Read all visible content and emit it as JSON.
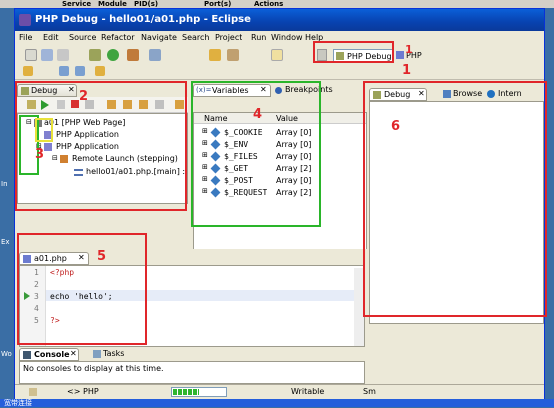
{
  "desktop": {
    "top_strip": [
      "Service",
      "Module",
      "PID(s)",
      "Port(s)",
      "Actions"
    ],
    "left_labels": [
      "In",
      "Ex",
      "Wo"
    ],
    "taskbar_label": "宽带连接"
  },
  "window": {
    "title": "PHP Debug - hello01/a01.php - Eclipse"
  },
  "menu": [
    "File",
    "Edit",
    "Source",
    "Refactor",
    "Navigate",
    "Search",
    "Project",
    "Run",
    "Window",
    "Help"
  ],
  "perspectives": {
    "active": "PHP Debug",
    "other": "PHP"
  },
  "debug_view": {
    "tab_label": "Debug",
    "tree": [
      {
        "label": "a01 [PHP Web Page]",
        "level": 0
      },
      {
        "label": "PHP Application",
        "level": 1
      },
      {
        "label": "PHP Application",
        "level": 1
      },
      {
        "label": "Remote Launch (stepping)",
        "level": 2
      },
      {
        "label": "hello01/a01.php.[main] :",
        "level": 3
      }
    ]
  },
  "variables_view": {
    "tabs": [
      "Variables",
      "Breakpoints"
    ],
    "columns": [
      "Name",
      "Value"
    ],
    "rows": [
      {
        "name": "$_COOKIE",
        "value": "Array [0]"
      },
      {
        "name": "$_ENV",
        "value": "Array [0]"
      },
      {
        "name": "$_FILES",
        "value": "Array [0]"
      },
      {
        "name": "$_GET",
        "value": "Array [2]"
      },
      {
        "name": "$_POST",
        "value": "Array [0]"
      },
      {
        "name": "$_REQUEST",
        "value": "Array [2]"
      }
    ]
  },
  "right_view": {
    "tabs": [
      "Debug",
      "Browse",
      "Intern"
    ]
  },
  "editor": {
    "tab_label": "a01.php",
    "lines": [
      {
        "num": "1",
        "code": "<?php"
      },
      {
        "num": "2",
        "code": ""
      },
      {
        "num": "3",
        "code": "echo 'hello';"
      },
      {
        "num": "4",
        "code": ""
      },
      {
        "num": "5",
        "code": "?>"
      }
    ]
  },
  "console": {
    "tabs": [
      "Console",
      "Tasks"
    ],
    "message": "No consoles to display at this time."
  },
  "status_bar": {
    "php_label": "PHP",
    "writable": "Writable",
    "sm": "Sm"
  },
  "annotations": {
    "n1": "1",
    "n1b": "1",
    "n2": "2",
    "n3": "3",
    "n4": "4",
    "n5": "5",
    "n6": "6",
    "color_red": "#e0262a",
    "color_green": "#2ab52a",
    "color_yellow": "#e8e23a"
  }
}
